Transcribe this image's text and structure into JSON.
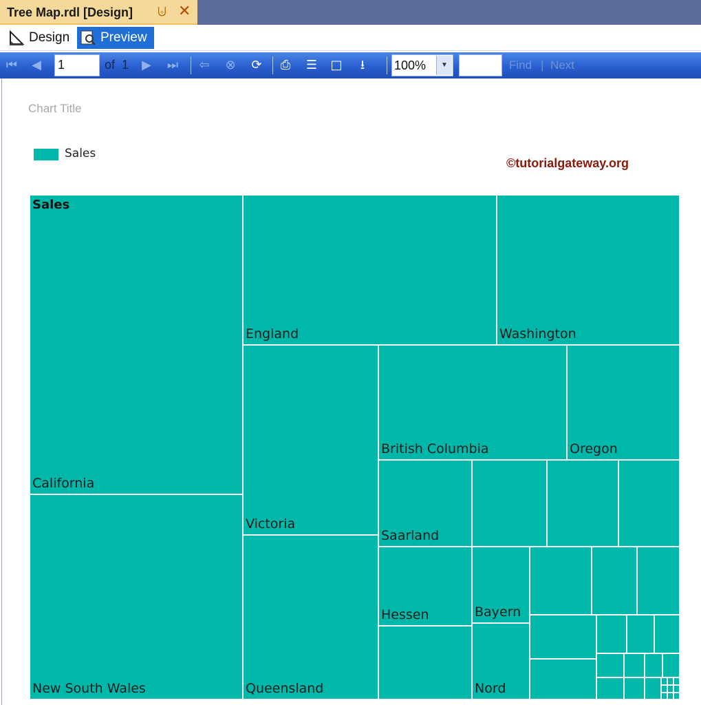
{
  "tab": {
    "title": "Tree Map.rdl [Design]",
    "pin_icon": "pin-icon",
    "close_icon": "close-icon"
  },
  "mode": {
    "design_label": "Design",
    "preview_label": "Preview",
    "active": "Preview"
  },
  "toolbar": {
    "page_current": "1",
    "of_text": "of",
    "page_total": "1",
    "zoom": "100%",
    "find_value": "",
    "find_label": "Find",
    "separator": "|",
    "next_label": "Next"
  },
  "report": {
    "chart_title": "Chart Title",
    "legend_label": "Sales",
    "watermark": "©tutorialgateway.org"
  },
  "chart_data": {
    "type": "treemap",
    "title": "Chart Title",
    "series": [
      {
        "name": "Sales",
        "color": "#00b8a9"
      }
    ],
    "labels": [
      "California",
      "New South Wales",
      "England",
      "Washington",
      "Victoria",
      "Queensland",
      "British Columbia",
      "Oregon",
      "Saarland",
      "Hessen",
      "Bayern",
      "Nord"
    ],
    "header_label": "Sales"
  },
  "colors": {
    "tile": "#00b8a9",
    "accent": "#1f6fd6",
    "toolbar": "#2a5fcf"
  }
}
